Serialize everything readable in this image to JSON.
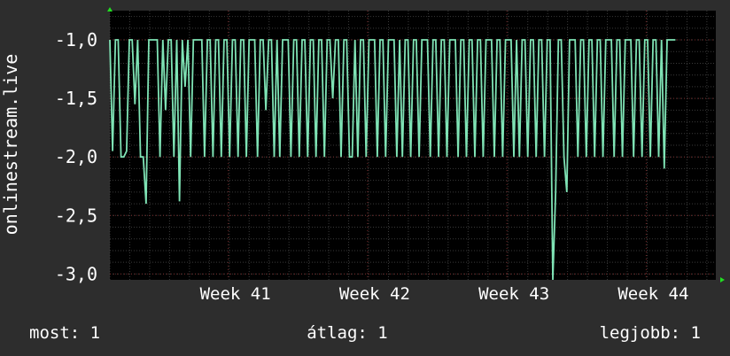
{
  "colors": {
    "background": "#2d2d2d",
    "plot_background": "#000000",
    "line": "#7fe3b5",
    "grid": "#3a3a3a",
    "grid_major": "#7a2a2a",
    "axis_arrow": "#22dd22",
    "text": "#ffffff"
  },
  "footer": {
    "current": "most: 1",
    "average": "átlag: 1",
    "best": "legjobb: 1"
  },
  "chart_data": {
    "type": "line",
    "ylabel": "onlinestream.live",
    "ylim": [
      -3.05,
      -0.75
    ],
    "yticks": [
      {
        "value": -1.0,
        "label": "-1,0"
      },
      {
        "value": -1.5,
        "label": "-1,5"
      },
      {
        "value": -2.0,
        "label": "-2,0"
      },
      {
        "value": -2.5,
        "label": "-2,5"
      },
      {
        "value": -3.0,
        "label": "-3,0"
      }
    ],
    "xlim": [
      0,
      4.35
    ],
    "xticks": [
      {
        "value": 0.85,
        "label": "Week 41"
      },
      {
        "value": 1.85,
        "label": "Week 42"
      },
      {
        "value": 2.85,
        "label": "Week 43"
      },
      {
        "value": 3.85,
        "label": "Week 44"
      }
    ],
    "x": [
      0.0,
      0.02,
      0.04,
      0.06,
      0.08,
      0.1,
      0.12,
      0.14,
      0.16,
      0.18,
      0.2,
      0.22,
      0.24,
      0.26,
      0.28,
      0.3,
      0.32,
      0.34,
      0.36,
      0.38,
      0.4,
      0.42,
      0.44,
      0.46,
      0.48,
      0.5,
      0.52,
      0.54,
      0.56,
      0.58,
      0.6,
      0.62,
      0.64,
      0.66,
      0.68,
      0.7,
      0.72,
      0.74,
      0.76,
      0.78,
      0.8,
      0.82,
      0.84,
      0.86,
      0.88,
      0.9,
      0.92,
      0.94,
      0.96,
      0.98,
      1.0,
      1.02,
      1.04,
      1.06,
      1.08,
      1.1,
      1.12,
      1.14,
      1.16,
      1.18,
      1.2,
      1.22,
      1.24,
      1.26,
      1.28,
      1.3,
      1.32,
      1.34,
      1.36,
      1.38,
      1.4,
      1.42,
      1.44,
      1.46,
      1.48,
      1.5,
      1.52,
      1.54,
      1.56,
      1.58,
      1.6,
      1.62,
      1.64,
      1.66,
      1.68,
      1.7,
      1.72,
      1.74,
      1.76,
      1.78,
      1.8,
      1.82,
      1.84,
      1.86,
      1.88,
      1.9,
      1.92,
      1.94,
      1.96,
      1.98,
      2.0,
      2.02,
      2.04,
      2.06,
      2.08,
      2.1,
      2.12,
      2.14,
      2.16,
      2.18,
      2.2,
      2.22,
      2.24,
      2.26,
      2.28,
      2.3,
      2.32,
      2.34,
      2.36,
      2.38,
      2.4,
      2.42,
      2.44,
      2.46,
      2.48,
      2.5,
      2.52,
      2.54,
      2.56,
      2.58,
      2.6,
      2.62,
      2.64,
      2.66,
      2.68,
      2.7,
      2.72,
      2.74,
      2.76,
      2.78,
      2.8,
      2.82,
      2.84,
      2.86,
      2.88,
      2.9,
      2.92,
      2.94,
      2.96,
      2.98,
      3.0,
      3.02,
      3.04,
      3.06,
      3.08,
      3.1,
      3.12,
      3.14,
      3.16,
      3.18,
      3.2,
      3.22,
      3.24,
      3.26,
      3.28,
      3.3,
      3.32,
      3.34,
      3.36,
      3.38,
      3.4,
      3.42,
      3.44,
      3.46,
      3.48,
      3.5,
      3.52,
      3.54,
      3.56,
      3.58,
      3.6,
      3.62,
      3.64,
      3.66,
      3.68,
      3.7,
      3.72,
      3.74,
      3.76,
      3.78,
      3.8,
      3.82,
      3.84,
      3.86,
      3.88,
      3.9,
      3.92,
      3.94,
      3.96,
      3.98,
      4.0,
      4.02,
      4.04,
      4.06,
      4.08,
      4.1,
      4.12,
      4.14,
      4.16,
      4.18,
      4.2,
      4.22,
      4.24,
      4.26,
      4.28,
      4.3,
      4.32,
      4.34
    ],
    "series": [
      {
        "values": [
          -1.0,
          -1.95,
          -1.0,
          -1.0,
          -2.0,
          -2.0,
          -1.95,
          -1.0,
          -1.0,
          -1.55,
          -1.0,
          -2.0,
          -2.0,
          -2.4,
          -1.0,
          -1.0,
          -1.0,
          -1.0,
          -2.0,
          -1.0,
          -1.6,
          -1.0,
          -1.0,
          -2.0,
          -1.0,
          -2.38,
          -1.0,
          -1.4,
          -1.0,
          -2.0,
          -1.0,
          -1.0,
          -1.0,
          -1.0,
          -2.0,
          -1.0,
          -1.0,
          -2.0,
          -1.0,
          -1.0,
          -2.0,
          -1.0,
          -1.0,
          -2.0,
          -1.0,
          -1.0,
          -2.0,
          -1.0,
          -1.0,
          -2.0,
          -1.0,
          -1.0,
          -1.0,
          -2.0,
          -1.0,
          -1.0,
          -1.6,
          -1.0,
          -1.0,
          -2.0,
          -1.0,
          -2.0,
          -1.0,
          -1.0,
          -1.0,
          -2.0,
          -1.0,
          -1.0,
          -2.0,
          -1.0,
          -1.0,
          -2.0,
          -1.0,
          -1.0,
          -2.0,
          -1.0,
          -1.0,
          -2.0,
          -1.0,
          -1.0,
          -1.5,
          -1.0,
          -1.0,
          -2.0,
          -1.0,
          -1.0,
          -2.0,
          -2.0,
          -1.0,
          -2.0,
          -1.0,
          -1.0,
          -2.0,
          -1.0,
          -1.0,
          -1.0,
          -2.0,
          -1.0,
          -1.0,
          -2.0,
          -1.0,
          -1.0,
          -1.0,
          -2.0,
          -1.0,
          -2.0,
          -1.0,
          -1.0,
          -2.0,
          -1.0,
          -1.0,
          -2.0,
          -1.0,
          -1.0,
          -1.0,
          -2.0,
          -1.0,
          -1.0,
          -2.0,
          -1.0,
          -1.0,
          -2.0,
          -1.0,
          -1.0,
          -1.0,
          -2.0,
          -1.0,
          -1.0,
          -2.0,
          -1.0,
          -1.0,
          -2.0,
          -1.0,
          -1.0,
          -2.0,
          -1.0,
          -1.0,
          -1.0,
          -2.0,
          -1.0,
          -1.0,
          -2.0,
          -1.0,
          -1.0,
          -1.0,
          -2.0,
          -1.0,
          -2.0,
          -1.0,
          -1.0,
          -2.0,
          -1.0,
          -1.0,
          -2.0,
          -1.0,
          -1.0,
          -2.0,
          -1.0,
          -1.0,
          -3.05,
          -2.3,
          -1.0,
          -1.0,
          -2.0,
          -2.3,
          -1.0,
          -1.0,
          -1.0,
          -2.0,
          -1.0,
          -1.0,
          -2.0,
          -1.0,
          -1.0,
          -2.0,
          -1.0,
          -1.0,
          -2.0,
          -1.0,
          -1.0,
          -1.0,
          -2.0,
          -1.0,
          -1.0,
          -2.0,
          -1.0,
          -1.0,
          -1.0,
          -2.0,
          -1.0,
          -1.0,
          -2.0,
          -1.0,
          -1.0,
          -2.0,
          -1.0,
          -1.0,
          -2.0,
          -1.0,
          -2.1,
          -1.0,
          -1.0,
          -1.0,
          -1.0
        ]
      }
    ]
  }
}
